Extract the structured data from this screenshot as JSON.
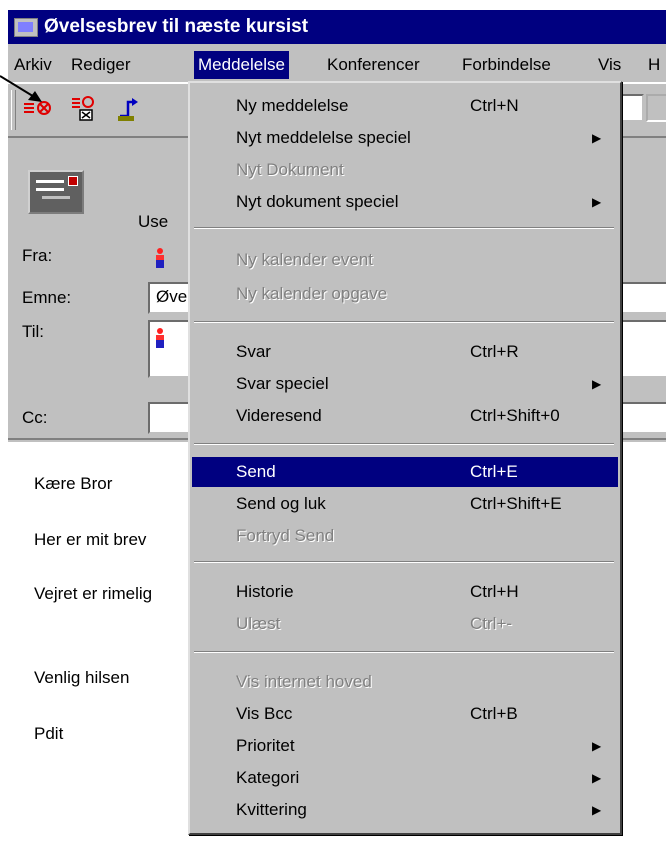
{
  "window": {
    "title": "Øvelsesbrev til næste kursist"
  },
  "menubar": {
    "items": [
      {
        "label": "Arkiv",
        "active": false
      },
      {
        "label": "Rediger",
        "active": false
      },
      {
        "label": "Meddelelse",
        "active": true
      },
      {
        "label": "Konferencer",
        "active": false
      },
      {
        "label": "Forbindelse",
        "active": false
      },
      {
        "label": "Vis",
        "active": false
      },
      {
        "label": "H",
        "active": false
      }
    ]
  },
  "toolbar": {
    "icons": [
      "send-icon",
      "send-and-close-icon",
      "reply-icon"
    ]
  },
  "header": {
    "user_label": "Use",
    "from_label": "Fra:",
    "subject_label": "Emne:",
    "subject_value": "Øve",
    "to_label": "Til:",
    "cc_label": "Cc:"
  },
  "body": {
    "lines": [
      "Kære Bror",
      "Her er mit brev",
      "Vejret er rimelig",
      "Venlig hilsen",
      "Pdit"
    ]
  },
  "menu": {
    "items": [
      {
        "label": "Ny meddelelse",
        "shortcut": "Ctrl+N",
        "submenu": false,
        "disabled": false,
        "highlighted": false
      },
      {
        "label": "Nyt meddelelse speciel",
        "shortcut": "",
        "submenu": true,
        "disabled": false,
        "highlighted": false
      },
      {
        "label": "Nyt Dokument",
        "shortcut": "",
        "submenu": false,
        "disabled": true,
        "highlighted": false
      },
      {
        "label": "Nyt dokument speciel",
        "shortcut": "",
        "submenu": true,
        "disabled": false,
        "highlighted": false
      },
      {
        "label": "Ny kalender event",
        "shortcut": "",
        "submenu": false,
        "disabled": true,
        "highlighted": false
      },
      {
        "label": "Ny kalender opgave",
        "shortcut": "",
        "submenu": false,
        "disabled": true,
        "highlighted": false
      },
      {
        "label": "Svar",
        "shortcut": "Ctrl+R",
        "submenu": false,
        "disabled": false,
        "highlighted": false
      },
      {
        "label": "Svar speciel",
        "shortcut": "",
        "submenu": true,
        "disabled": false,
        "highlighted": false
      },
      {
        "label": "Videresend",
        "shortcut": "Ctrl+Shift+0",
        "submenu": false,
        "disabled": false,
        "highlighted": false
      },
      {
        "label": "Send",
        "shortcut": "Ctrl+E",
        "submenu": false,
        "disabled": false,
        "highlighted": true
      },
      {
        "label": "Send og luk",
        "shortcut": "Ctrl+Shift+E",
        "submenu": false,
        "disabled": false,
        "highlighted": false
      },
      {
        "label": "Fortryd Send",
        "shortcut": "",
        "submenu": false,
        "disabled": true,
        "highlighted": false
      },
      {
        "label": "Historie",
        "shortcut": "Ctrl+H",
        "submenu": false,
        "disabled": false,
        "highlighted": false
      },
      {
        "label": "Ulæst",
        "shortcut": "Ctrl+-",
        "submenu": false,
        "disabled": true,
        "highlighted": false
      },
      {
        "label": "Vis internet hoved",
        "shortcut": "",
        "submenu": false,
        "disabled": true,
        "highlighted": false
      },
      {
        "label": "Vis Bcc",
        "shortcut": "Ctrl+B",
        "submenu": false,
        "disabled": false,
        "highlighted": false
      },
      {
        "label": "Prioritet",
        "shortcut": "",
        "submenu": true,
        "disabled": false,
        "highlighted": false
      },
      {
        "label": "Kategori",
        "shortcut": "",
        "submenu": true,
        "disabled": false,
        "highlighted": false
      },
      {
        "label": "Kvittering",
        "shortcut": "",
        "submenu": true,
        "disabled": false,
        "highlighted": false
      }
    ]
  },
  "colors": {
    "titlebar": "#000080",
    "face": "#c0c0c0",
    "highlight": "#000080",
    "icon_red": "#e00000"
  }
}
